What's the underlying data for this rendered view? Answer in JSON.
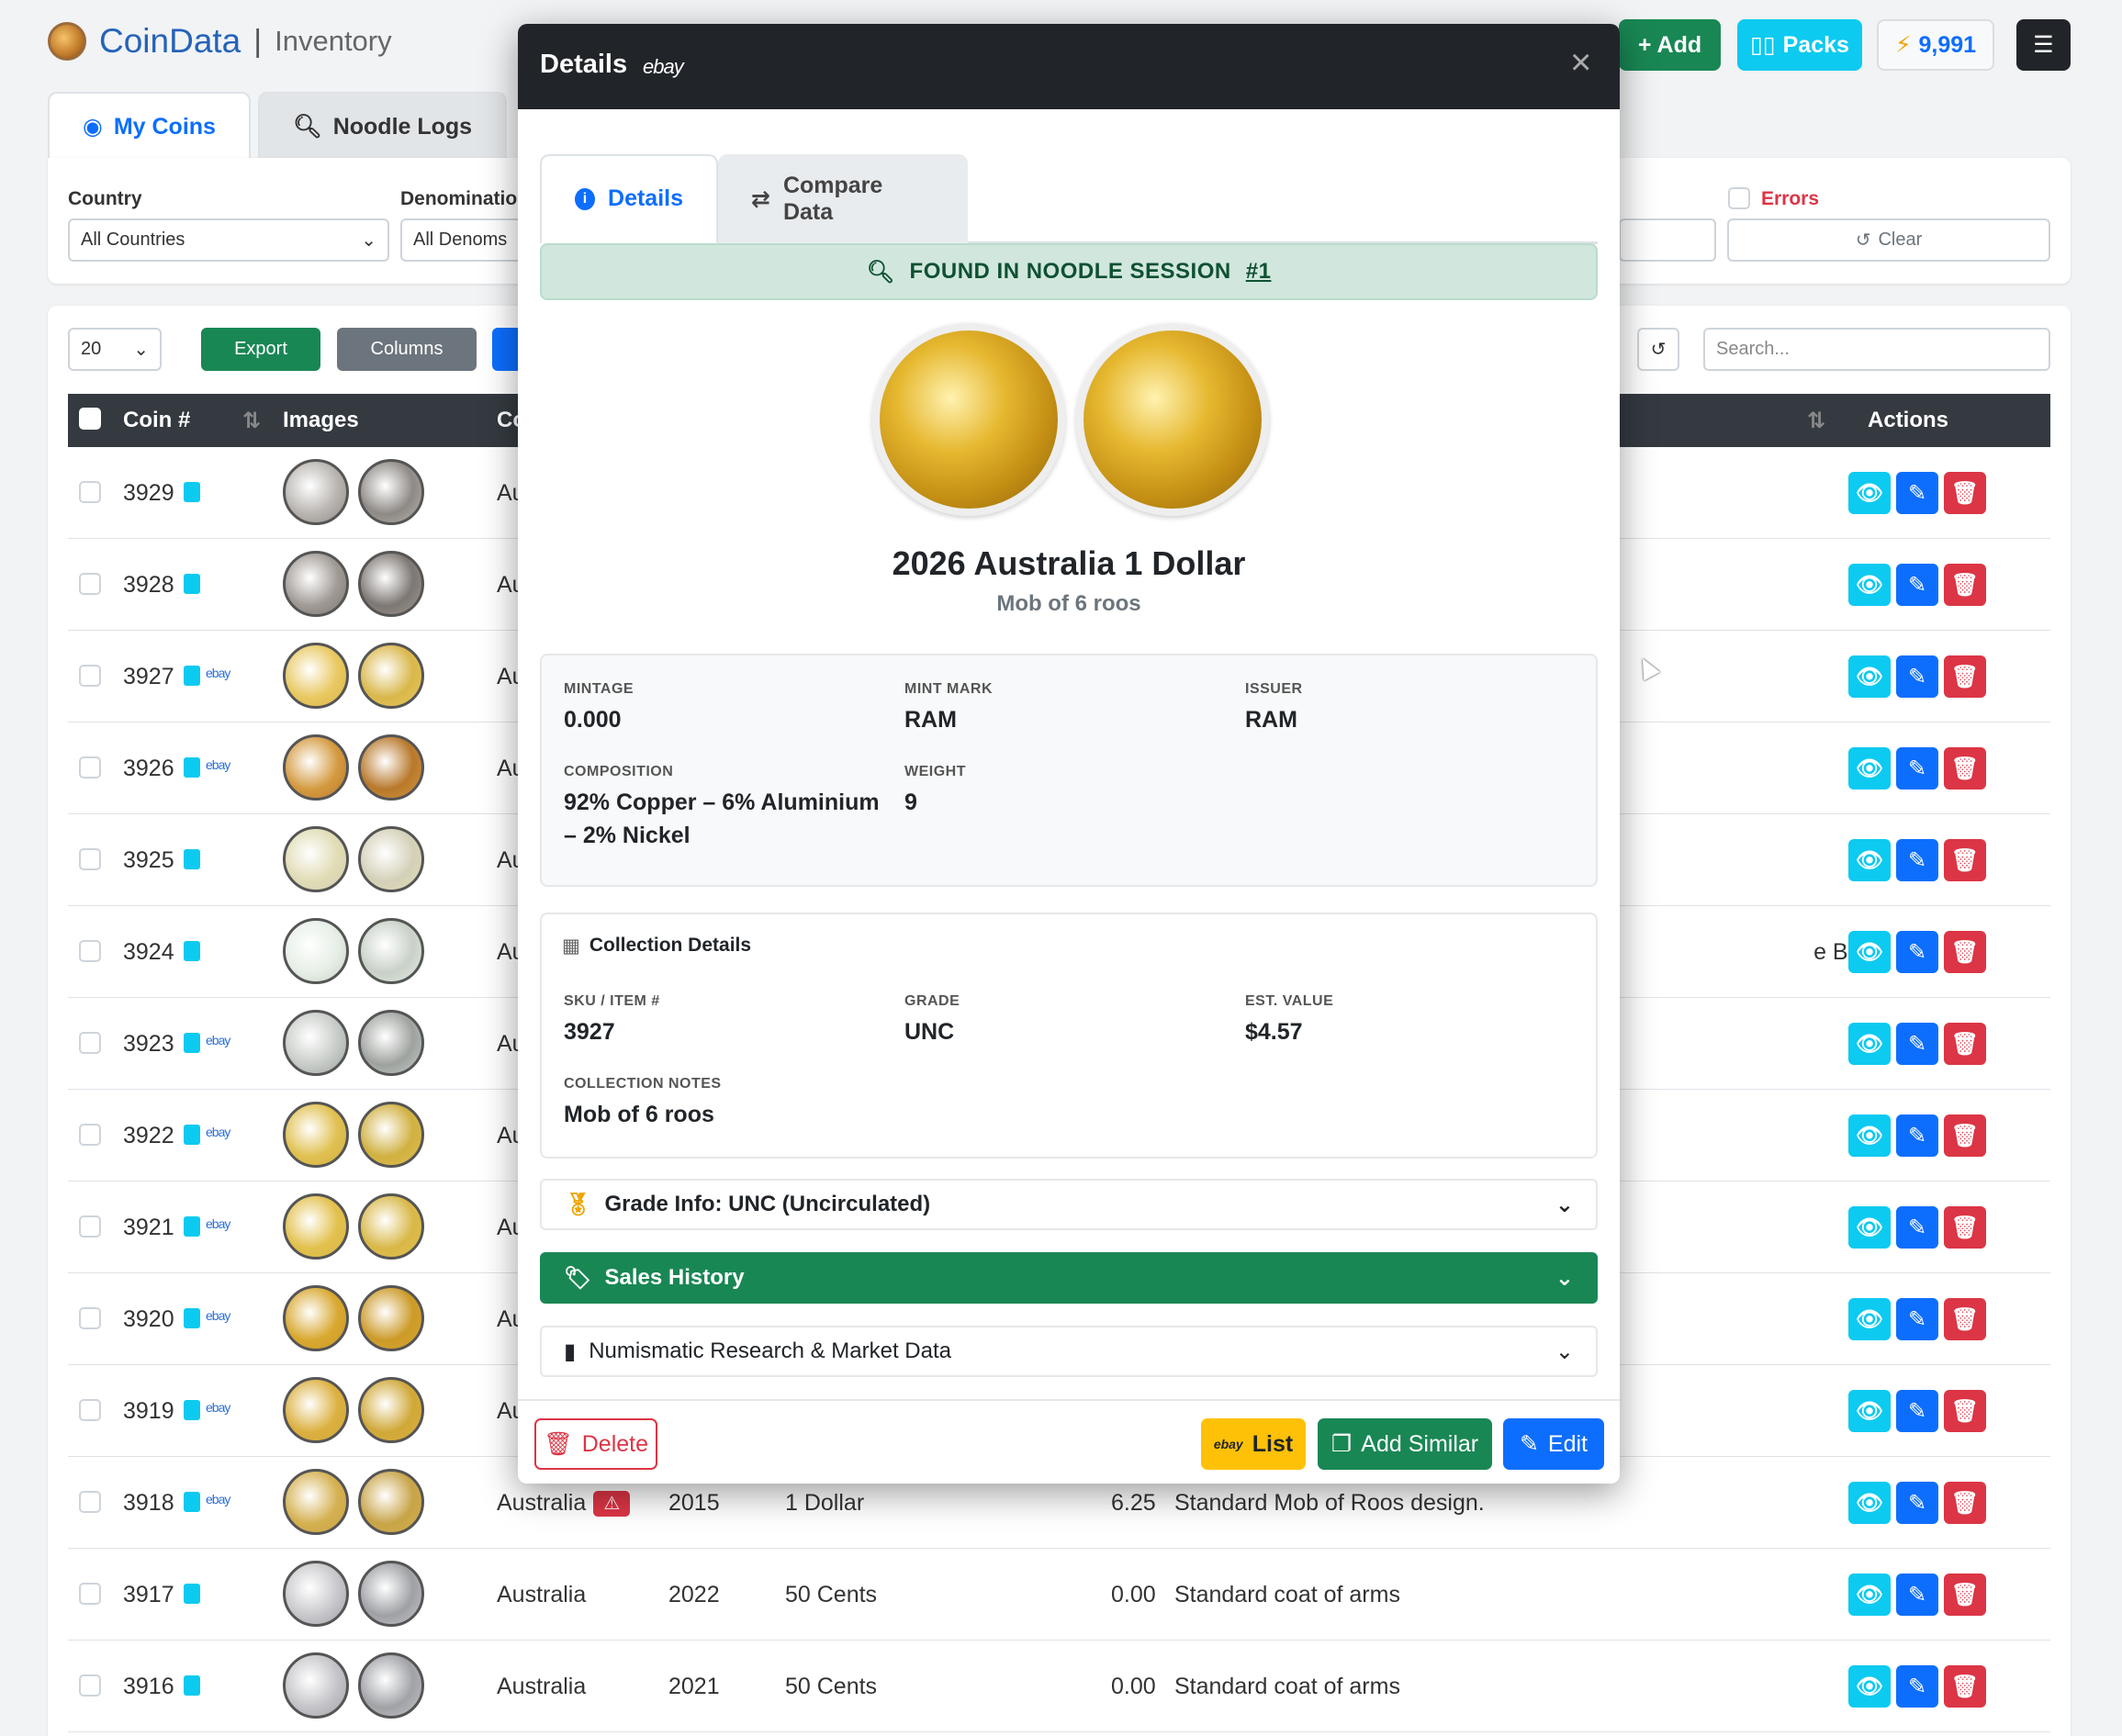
{
  "app": {
    "name": "CoinData",
    "separator": "|",
    "section": "Inventory"
  },
  "header_buttons": {
    "add": "+ Add",
    "packs": "Packs",
    "credits": "9,991"
  },
  "top_tabs": [
    {
      "label": "My Coins"
    },
    {
      "label": "Noodle Logs"
    }
  ],
  "filters": {
    "country_label": "Country",
    "country_value": "All Countries",
    "denom_label": "Denominatio",
    "denom_value": "All Denoms",
    "errors_label": "Errors",
    "clear_label": "Clear"
  },
  "toolbar": {
    "page_size": "20",
    "export_label": "Export",
    "columns_label": "Columns",
    "search_placeholder": "Search..."
  },
  "table": {
    "headers": {
      "coin": "Coin #",
      "images": "Images",
      "country_partial": "Co",
      "actions": "Actions"
    },
    "rows": [
      {
        "id": "3929",
        "ebay": false,
        "country": "Au",
        "year": "",
        "denom": "",
        "value": "",
        "notes": ""
      },
      {
        "id": "3928",
        "ebay": false,
        "country": "Au",
        "year": "",
        "denom": "",
        "value": "",
        "notes": ""
      },
      {
        "id": "3927",
        "ebay": true,
        "country": "Au",
        "year": "",
        "denom": "",
        "value": "",
        "notes": ""
      },
      {
        "id": "3926",
        "ebay": true,
        "country": "Au",
        "year": "",
        "denom": "",
        "value": "",
        "notes": ""
      },
      {
        "id": "3925",
        "ebay": false,
        "country": "Au",
        "year": "",
        "denom": "",
        "value": "",
        "notes": ""
      },
      {
        "id": "3924",
        "ebay": false,
        "country": "Au",
        "year": "",
        "denom": "",
        "value": "",
        "notes": "e Box"
      },
      {
        "id": "3923",
        "ebay": true,
        "country": "Au",
        "year": "",
        "denom": "",
        "value": "",
        "notes": ""
      },
      {
        "id": "3922",
        "ebay": true,
        "country": "Au",
        "year": "",
        "denom": "",
        "value": "",
        "notes": ""
      },
      {
        "id": "3921",
        "ebay": true,
        "country": "Au",
        "year": "",
        "denom": "",
        "value": "",
        "notes": ""
      },
      {
        "id": "3920",
        "ebay": true,
        "country": "Au",
        "year": "",
        "denom": "",
        "value": "",
        "notes": ""
      },
      {
        "id": "3919",
        "ebay": true,
        "country": "Au",
        "year": "",
        "denom": "",
        "value": "",
        "notes": ""
      },
      {
        "id": "3918",
        "ebay": true,
        "country": "Australia",
        "year": "2015",
        "denom": "1 Dollar",
        "value": "6.25",
        "notes": "Standard Mob of Roos design."
      },
      {
        "id": "3917",
        "ebay": false,
        "country": "Australia",
        "year": "2022",
        "denom": "50 Cents",
        "value": "0.00",
        "notes": "Standard coat of arms"
      },
      {
        "id": "3916",
        "ebay": false,
        "country": "Australia",
        "year": "2021",
        "denom": "50 Cents",
        "value": "0.00",
        "notes": "Standard coat of arms"
      }
    ],
    "ebay_text": "ebay"
  },
  "modal": {
    "title": "Details",
    "title_badge": "ebay",
    "tabs": [
      {
        "label": "Details"
      },
      {
        "label": "Compare Data"
      }
    ],
    "found_text": "FOUND IN NOODLE SESSION",
    "found_link": "#1",
    "coin_title": "2026 Australia 1 Dollar",
    "coin_subtitle": "Mob of 6 roos",
    "specs": {
      "mintage_label": "MINTAGE",
      "mintage": "0.000",
      "mintmark_label": "MINT MARK",
      "mintmark": "RAM",
      "issuer_label": "ISSUER",
      "issuer": "RAM",
      "composition_label": "COMPOSITION",
      "composition": "92% Copper – 6% Aluminium – 2% Nickel",
      "weight_label": "WEIGHT",
      "weight": "9"
    },
    "collection": {
      "title": "Collection Details",
      "sku_label": "SKU / ITEM #",
      "sku": "3927",
      "grade_label": "GRADE",
      "grade": "UNC",
      "value_label": "EST. VALUE",
      "value": "$4.57",
      "notes_label": "COLLECTION NOTES",
      "notes": "Mob of 6 roos"
    },
    "accordions": {
      "grade": "Grade Info: UNC (Uncirculated)",
      "sales": "Sales History",
      "research": "Numismatic Research & Market Data"
    },
    "footer": {
      "delete": "Delete",
      "list_badge": "ebay",
      "list": "List",
      "add_similar": "Add Similar",
      "edit": "Edit"
    }
  },
  "colors": {
    "primary": "#0d6efd",
    "success": "#198754",
    "info": "#0dcaf0",
    "danger": "#dc3545",
    "dark": "#212529",
    "warning": "#ffc107"
  }
}
